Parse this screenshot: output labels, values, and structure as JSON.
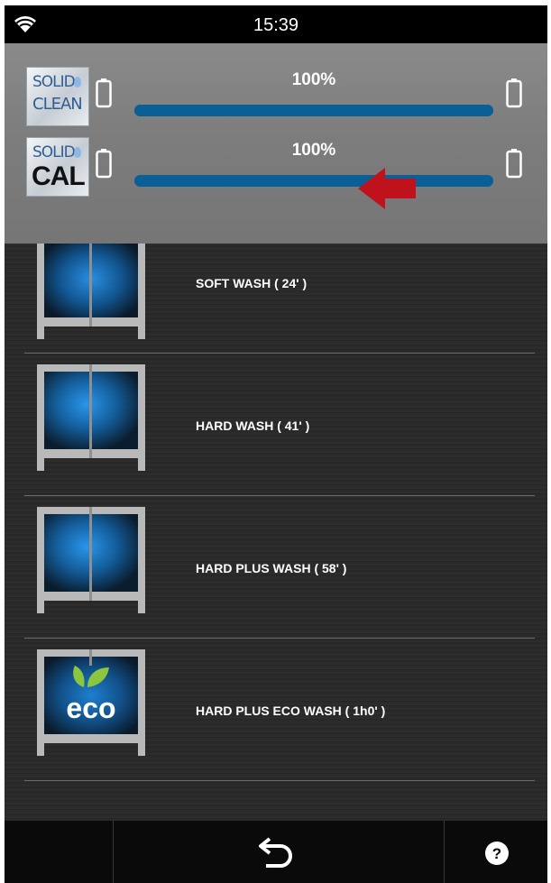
{
  "status_bar": {
    "time": "15:39",
    "wifi_icon": "wifi-icon"
  },
  "cartridges": [
    {
      "logo_line1": "SOLID",
      "logo_line2": "CLEAN",
      "percent_label": "100%",
      "level_fraction": 1.0,
      "left_icon": "battery-empty-icon",
      "right_icon": "battery-full-icon"
    },
    {
      "logo_line1": "SOLID",
      "logo_line2": "CAL",
      "percent_label": "100%",
      "level_fraction": 1.0,
      "left_icon": "battery-empty-icon",
      "right_icon": "battery-full-icon"
    }
  ],
  "annotation": {
    "icon": "red-arrow-icon",
    "color": "#c0121c"
  },
  "programs": [
    {
      "label": "SOFT WASH ( 24' )",
      "icon": "dishwasher-icon"
    },
    {
      "label": "HARD WASH ( 41' )",
      "icon": "dishwasher-icon"
    },
    {
      "label": "HARD PLUS WASH ( 58' )",
      "icon": "dishwasher-icon"
    },
    {
      "label": "HARD PLUS ECO WASH ( 1h0' )",
      "icon": "eco-dishwasher-icon",
      "eco_text": "eco"
    }
  ],
  "nav": {
    "back_icon": "back-icon",
    "help_icon": "help-icon"
  },
  "colors": {
    "bar_track": "#0e5481",
    "panel_bg": "#808080",
    "eco_green": "#8cc63f"
  }
}
